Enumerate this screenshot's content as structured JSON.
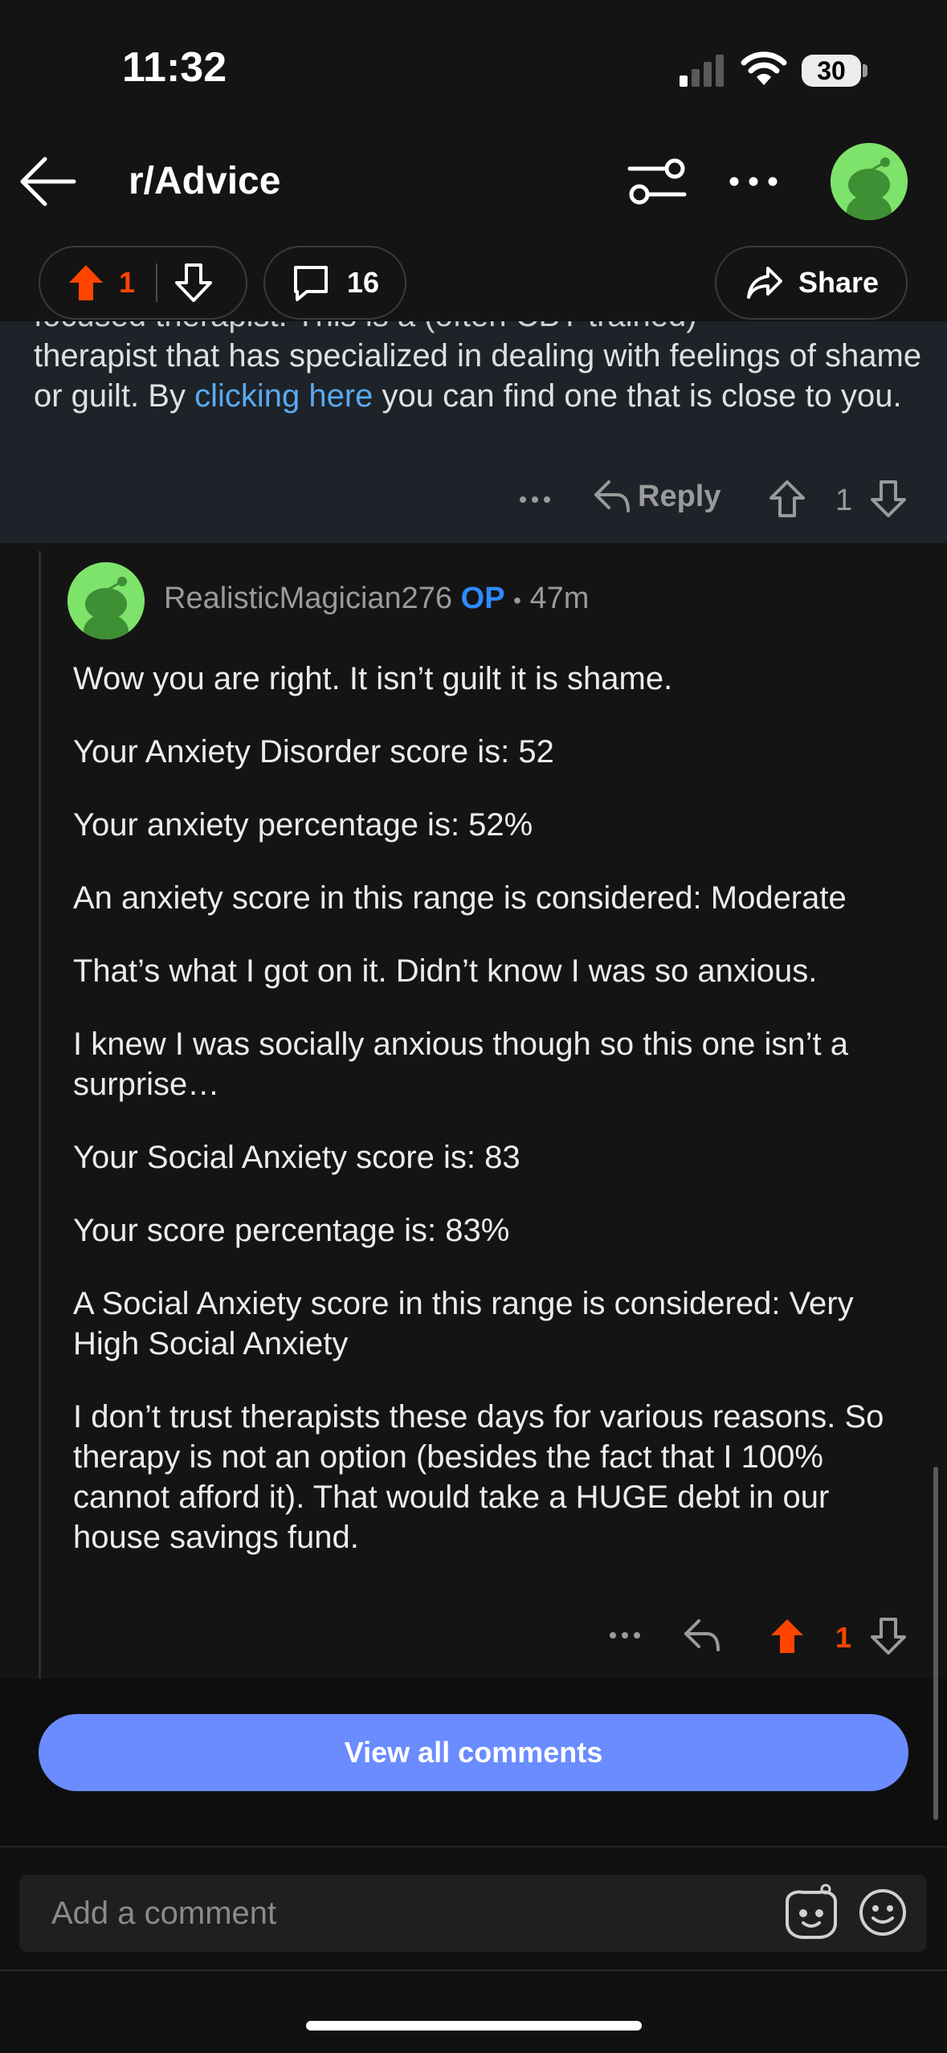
{
  "status_bar": {
    "time": "11:32",
    "battery": "30"
  },
  "header": {
    "title": "r/Advice"
  },
  "post_actions": {
    "vote_count": "1",
    "comment_count": "16",
    "share_label": "Share"
  },
  "parent_comment": {
    "line_partial": "focused therapist. This is a (often CBT trained)",
    "text_before_link": "therapist that has specialized in dealing with feelings of shame or guilt. By ",
    "link_text": "clicking here",
    "text_after_link": " you can find one that is close to you.",
    "reply_label": "Reply",
    "vote_count": "1"
  },
  "reply_comment": {
    "author": "RealisticMagician276",
    "op_badge": "OP",
    "separator": "•",
    "time_ago": "47m",
    "paragraphs": [
      "Wow you are right. It isn’t guilt it is shame.",
      "Your Anxiety Disorder score is: 52",
      "Your anxiety percentage is: 52%",
      "An anxiety score in this range is considered: Moderate",
      "That’s what I got on it. Didn’t know I was so anxious.",
      "I knew I was socially anxious though so this one isn’t a surprise…",
      "Your Social Anxiety score is: 83",
      "Your score percentage is: 83%",
      "A Social Anxiety score in this range is considered: Very High Social Anxiety",
      "I don’t trust therapists these days for various reasons. So therapy is not an option (besides the fact that I 100% cannot afford it). That would take a HUGE debt in our house savings fund."
    ],
    "vote_count": "1"
  },
  "view_all_label": "View all comments",
  "composer": {
    "placeholder": "Add a comment"
  },
  "colors": {
    "upvote": "#ff4500",
    "link": "#5aa9f0",
    "op": "#2e8bff",
    "button": "#6a8cff"
  }
}
